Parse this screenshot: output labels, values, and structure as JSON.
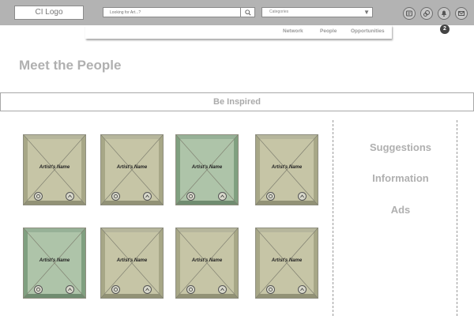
{
  "header": {
    "logo": "CI Logo",
    "search": {
      "placeholder": "Looking for Art...?"
    },
    "category_select": {
      "value": "Categories"
    },
    "notification_count": "2"
  },
  "nav": {
    "items": [
      "Network",
      "People",
      "Opportunities"
    ]
  },
  "page": {
    "title": "Meet the People",
    "banner": "Be Inspired"
  },
  "cards": [
    {
      "name": "Artist's Name",
      "highlighted": false
    },
    {
      "name": "Artist's Name",
      "highlighted": false
    },
    {
      "name": "Artist's Name",
      "highlighted": true
    },
    {
      "name": "Artist's Name",
      "highlighted": false
    },
    {
      "name": "Artist's Name",
      "highlighted": true
    },
    {
      "name": "Artist's Name",
      "highlighted": false
    },
    {
      "name": "Artist's Name",
      "highlighted": false
    },
    {
      "name": "Artist's Name",
      "highlighted": false
    }
  ],
  "sidebar": {
    "items": [
      "Suggestions",
      "Information",
      "Ads"
    ]
  },
  "colors": {
    "card_default": "#c6c5a6",
    "card_default_border": "#a7a787",
    "card_highlight": "#aec4a9",
    "card_highlight_border": "#80a080",
    "topbar": "#b3b3b3"
  },
  "icons": [
    "search-icon",
    "chevron-down-icon",
    "settings-icon",
    "network-icon",
    "bell-icon",
    "message-icon",
    "like-icon",
    "share-icon"
  ]
}
